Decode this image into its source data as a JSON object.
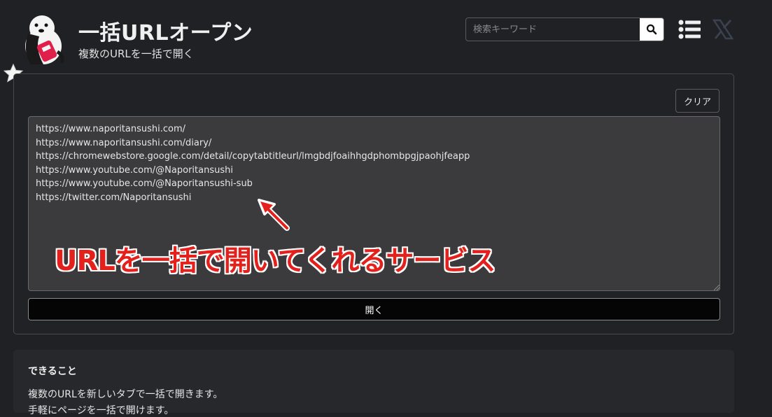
{
  "header": {
    "title": "一括URLオープン",
    "subtitle": "複数のURLを一括で開く",
    "logo_icon": "otter-mascot-icon",
    "favorite_icon": "star-icon"
  },
  "search": {
    "placeholder": "検索キーワード",
    "button_icon": "search-icon"
  },
  "nav": {
    "menu_icon": "list-menu-icon",
    "x_icon": "x-twitter-icon"
  },
  "tool": {
    "clear_label": "クリア",
    "urls_text": "https://www.naporitansushi.com/\nhttps://www.naporitansushi.com/diary/\nhttps://chromewebstore.google.com/detail/copytabtitleurl/lmgbdjfoaihhgdphombpgjpaohjfeapp\nhttps://www.youtube.com/@Naporitansushi\nhttps://www.youtube.com/@Naporitansushi-sub\nhttps://twitter.com/Naporitansushi",
    "open_label": "開く"
  },
  "annotation": {
    "text": "URLを一括で開いてくれるサービス",
    "color": "#e3201b"
  },
  "info": {
    "heading": "できること",
    "line1": "複数のURLを新しいタブで一括で開きます。",
    "line2": "手軽にページを一括で開けます。"
  },
  "colors": {
    "background": "#202124",
    "textarea": "#3b3b3d",
    "button": "#050505"
  }
}
